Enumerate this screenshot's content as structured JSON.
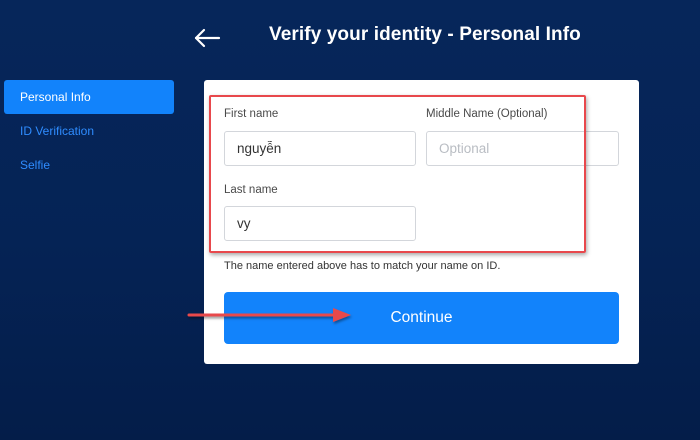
{
  "header": {
    "title": "Verify your identity - Personal Info",
    "back_icon": "back-arrow-icon"
  },
  "sidebar": {
    "items": [
      {
        "label": "Personal Info",
        "active": true
      },
      {
        "label": "ID Verification",
        "active": false
      },
      {
        "label": "Selfie",
        "active": false
      }
    ]
  },
  "form": {
    "first_name": {
      "label": "First name",
      "value": "nguyễn",
      "placeholder": ""
    },
    "middle_name": {
      "label": "Middle Name (Optional)",
      "value": "",
      "placeholder": "Optional"
    },
    "last_name": {
      "label": "Last name",
      "value": "vy",
      "placeholder": ""
    },
    "helper_text": "The name entered above has to match your name on ID.",
    "continue_label": "Continue"
  },
  "colors": {
    "background": "#052355",
    "accent": "#1283fb",
    "sidebar_link": "#2f8cff",
    "annotation_red": "#e8484c"
  }
}
